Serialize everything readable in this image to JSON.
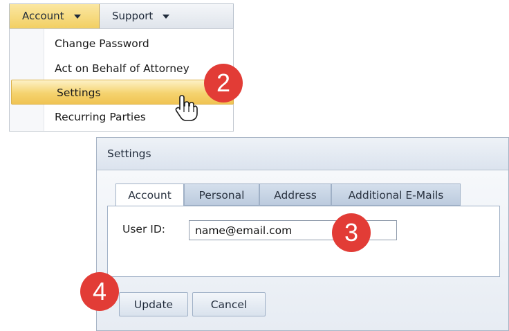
{
  "menubar": {
    "account_label": "Account",
    "support_label": "Support"
  },
  "dropdown": {
    "items": [
      {
        "label": "Change Password"
      },
      {
        "label": "Act on Behalf of Attorney"
      },
      {
        "label": "Settings",
        "highlighted": true
      },
      {
        "label": "Recurring Parties"
      }
    ]
  },
  "steps": {
    "step2": "2",
    "step3": "3",
    "step4": "4"
  },
  "dialog": {
    "title": "Settings",
    "tabs": [
      {
        "label": "Account",
        "active": true
      },
      {
        "label": "Personal"
      },
      {
        "label": "Address"
      },
      {
        "label": "Additional E-Mails"
      }
    ],
    "user_id_label": "User ID:",
    "user_id_value": "name@email.com",
    "update_label": "Update",
    "cancel_label": "Cancel"
  },
  "colors": {
    "highlight": "#f5d36f",
    "badge": "#e23c36",
    "tab_inactive": "#c6d4e5"
  },
  "icons": {
    "cursor": "hand-pointer-icon",
    "dropdown": "chevron-down-icon"
  }
}
